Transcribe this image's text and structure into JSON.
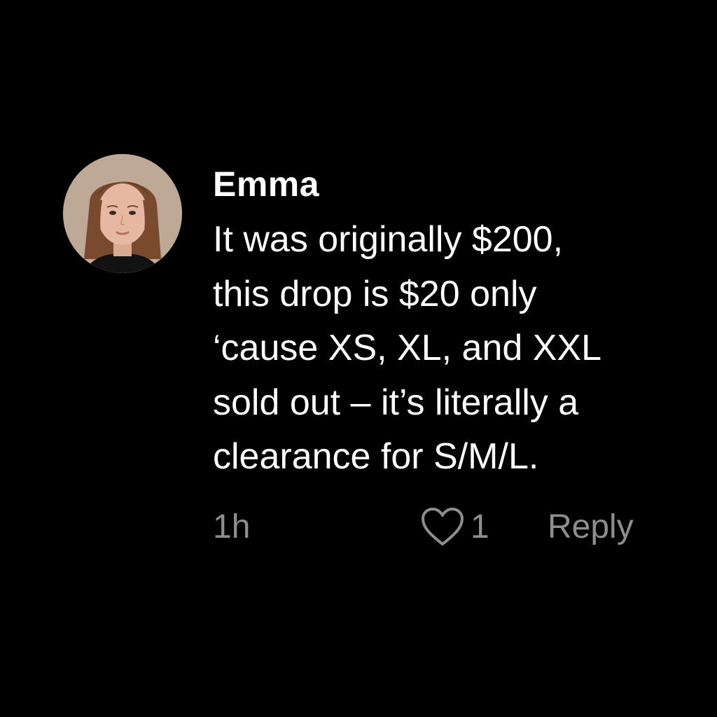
{
  "comment": {
    "author": "Emma",
    "lines": [
      "It was originally $200,",
      "this drop is $20 only",
      "‘cause XS, XL, and XXL",
      "sold out – it’s literally a",
      "clearance for S/M/L."
    ],
    "time": "1h",
    "like_count": "1",
    "reply_label": "Reply",
    "like_icon": "heart-outline-icon",
    "avatar": "profile-photo"
  },
  "colors": {
    "background": "#000000",
    "text_primary": "#ffffff",
    "text_secondary": "#8e8e8e"
  }
}
